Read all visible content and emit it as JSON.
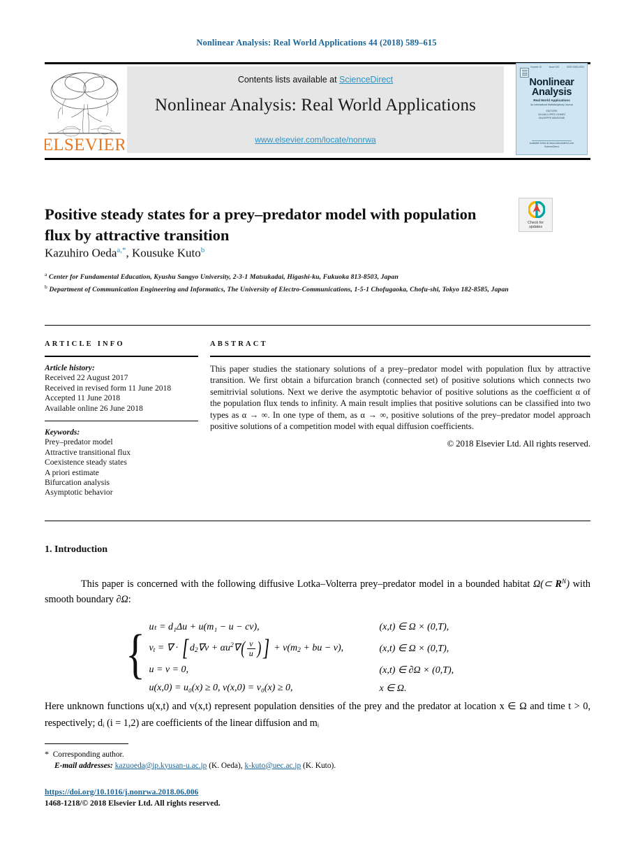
{
  "running_head": "Nonlinear Analysis: Real World Applications 44 (2018) 589–615",
  "masthead": {
    "contents_prefix": "Contents lists available at ",
    "sciencedirect": "ScienceDirect",
    "journal_title": "Nonlinear Analysis: Real World Applications",
    "url": "www.elsevier.com/locate/nonrwa",
    "publisher_logo_text": "ELSEVIER"
  },
  "cover": {
    "vol": "Volume 44",
    "issue": "Issue 000",
    "isbn": "ISSN 0000-0000",
    "title_line1": "Nonlinear",
    "title_line2": "Analysis",
    "subtitle": "Real World Applications",
    "subtitle2": "An International Multidisciplinary Journal",
    "editors_label": "EDITORS",
    "editor1": "JULIAN LOPEZ-GOMEZ",
    "editor2": "GIUSEPPE MINGIONE",
    "bottom_line1": "Available online at www.sciencedirect.com",
    "bottom_line2": "ScienceDirect"
  },
  "article": {
    "title": "Positive steady states for a prey–predator model with population flux by attractive transition",
    "crossmark_label_line1": "Check for",
    "crossmark_label_line2": "updates",
    "author1": "Kazuhiro Oeda",
    "author1_marks": "a,*",
    "author2": "Kousuke Kuto",
    "author2_marks": "b",
    "affiliation_a_mark": "a",
    "affiliation_a": "Center for Fundamental Education, Kyushu Sangyo University, 2-3-1 Matsukadai, Higashi-ku, Fukuoka 813-8503, Japan",
    "affiliation_b_mark": "b",
    "affiliation_b": "Department of Communication Engineering and Informatics, The University of Electro-Communications, 1-5-1 Chofugaoka, Chofu-shi, Tokyo 182-8585, Japan"
  },
  "info": {
    "heading": "ARTICLE INFO",
    "history_label": "Article history:",
    "history": [
      "Received 22 August 2017",
      "Received in revised form 11 June 2018",
      "Accepted 11 June 2018",
      "Available online 26 June 2018"
    ],
    "keywords_label": "Keywords:",
    "keywords": [
      "Prey–predator model",
      "Attractive transitional flux",
      "Coexistence steady states",
      "A priori estimate",
      "Bifurcation analysis",
      "Asymptotic behavior"
    ]
  },
  "abstract": {
    "heading": "ABSTRACT",
    "text": "This paper studies the stationary solutions of a prey–predator model with population flux by attractive transition. We first obtain a bifurcation branch (connected set) of positive solutions which connects two semitrivial solutions. Next we derive the asymptotic behavior of positive solutions as the coefficient α of the population flux tends to infinity. A main result implies that positive solutions can be classified into two types as α → ∞. In one type of them, as α → ∞, positive solutions of the prey–predator model approach positive solutions of a competition model with equal diffusion coefficients.",
    "copyright": "© 2018 Elsevier Ltd. All rights reserved."
  },
  "body": {
    "section_number_title": "1. Introduction",
    "paragraph1_a": "This paper is concerned with the following diffusive Lotka–Volterra prey–predator model in a bounded habitat ",
    "paragraph1_b": " with smooth boundary ",
    "paragraph1_c": ":",
    "paragraph2": "Here unknown functions u(x,t) and v(x,t) represent population densities of the prey and the predator at location x ∈ Ω and time t > 0, respectively; dᵢ (i = 1,2) are coefficients of the linear diffusion and mᵢ"
  },
  "equation": {
    "row1_lhs": "uₜ = d₁Δu + u(m₁ − u − cv),",
    "row1_rhs": "(x,t) ∈ Ω × (0,T),",
    "row2_rhs": "(x,t) ∈ Ω × (0,T),",
    "row3_lhs": "u = v = 0,",
    "row3_rhs": "(x,t) ∈ ∂Ω × (0,T),",
    "row4_lhs": "u(x,0) = u₀(x) ≥ 0,  v(x,0) = v₀(x) ≥ 0,",
    "row4_rhs": "x ∈ Ω."
  },
  "footnotes": {
    "corresponding": "Corresponding author.",
    "email_label": "E-mail addresses:",
    "email1": "kazuoeda@ip.kyusan-u.ac.jp",
    "email1_who": "(K. Oeda),",
    "email2": "k-kuto@uec.ac.jp",
    "email2_who": "(K. Kuto).",
    "doi": "https://doi.org/10.1016/j.nonrwa.2018.06.006",
    "issn": "1468-1218/© 2018 Elsevier Ltd. All rights reserved."
  },
  "colors": {
    "link": "#1a6496",
    "sciencedirect": "#2b93c4",
    "elsevier_orange": "#e87722",
    "masthead_bg": "#e6e6e6"
  }
}
